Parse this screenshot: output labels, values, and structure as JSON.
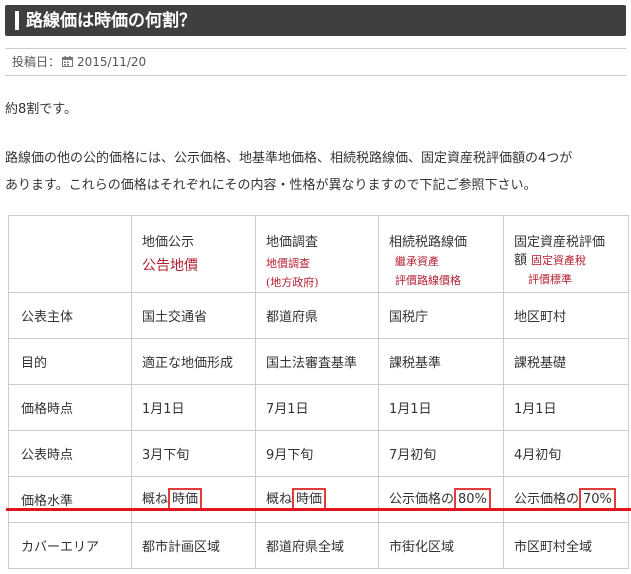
{
  "title": "路線価は時価の何割？",
  "meta": {
    "posted_label": "投稿日：",
    "date": "2015/11/20",
    "calendar_icon": "calendar-icon"
  },
  "paragraphs": [
    "約8割です。",
    "路線価の他の公的価格には、公示価格、地基準地価格、相続税路線価、固定資産税評価額の4つが",
    "あります。これらの価格はそれぞれにその内容・性格が異なりますので下記ご参照下さい。"
  ],
  "table": {
    "headers": [
      "",
      "地価公示",
      "地価調査",
      "相続税路線価",
      "固定資産税評価"
    ],
    "header_second_line": [
      "",
      "",
      "",
      "",
      "額"
    ],
    "handwritten": {
      "col1": [
        "公告地價"
      ],
      "col2": [
        "地價調查",
        "(地方政府)"
      ],
      "col3": [
        "繼承資產",
        "評價路線價格"
      ],
      "col4": [
        "固定資產稅",
        "評價標準"
      ]
    },
    "rows": [
      [
        "公表主体",
        "国土交通省",
        "都道府県",
        "国税庁",
        "地区町村"
      ],
      [
        "目的",
        "適正な地価形成",
        "国土法審査基準",
        "課税基準",
        "課税基礎"
      ],
      [
        "価格時点",
        "1月1日",
        "7月1日",
        "1月1日",
        "1月1日"
      ],
      [
        "公表時点",
        "3月下旬",
        "9月下旬",
        "7月初旬",
        "4月初旬"
      ]
    ],
    "level_row": {
      "label": "価格水準",
      "cells": [
        {
          "prefix": "概ね",
          "boxed": "時価"
        },
        {
          "prefix": "概ね",
          "boxed": "時価"
        },
        {
          "prefix": "公示価格の",
          "boxed": "80%"
        },
        {
          "prefix": "公示価格の",
          "boxed": "70%"
        }
      ]
    },
    "last_row": [
      "カバーエリア",
      "都市計画区域",
      "都道府県全域",
      "市街化区域",
      "市区町村全域"
    ]
  },
  "colors": {
    "title_bg": "#3f3f3f",
    "annotation": "#b42031",
    "highlight": "#e2141c",
    "border": "#cccccc"
  }
}
